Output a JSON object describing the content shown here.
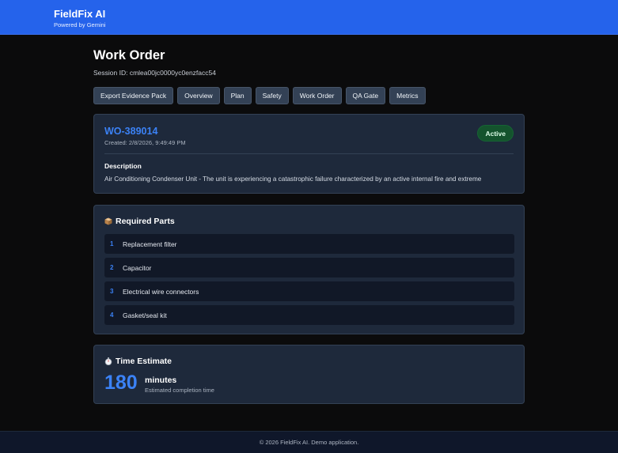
{
  "header": {
    "title": "FieldFix AI",
    "subtitle": "Powered by Gemini",
    "accent_color": "#2563eb"
  },
  "page": {
    "title": "Work Order",
    "session_label": "Session ID: cmlea00jc0000yc0enzfacc54"
  },
  "tabs": [
    {
      "label": "Export Evidence Pack"
    },
    {
      "label": "Overview"
    },
    {
      "label": "Plan"
    },
    {
      "label": "Safety"
    },
    {
      "label": "Work Order"
    },
    {
      "label": "QA Gate"
    },
    {
      "label": "Metrics"
    }
  ],
  "work_order": {
    "id": "WO-389014",
    "created": "Created: 2/8/2026, 9:49:49 PM",
    "status": "Active",
    "status_color": "#14532d",
    "description_label": "Description",
    "description": "Air Conditioning Condenser Unit - The unit is experiencing a catastrophic failure characterized by an active internal fire and extreme"
  },
  "parts": {
    "icon": "package-icon",
    "title": "Required Parts",
    "items": [
      {
        "num": "1",
        "name": "Replacement filter"
      },
      {
        "num": "2",
        "name": "Capacitor"
      },
      {
        "num": "3",
        "name": "Electrical wire connectors"
      },
      {
        "num": "4",
        "name": "Gasket/seal kit"
      }
    ]
  },
  "time_estimate": {
    "icon": "stopwatch-icon",
    "title": "Time Estimate",
    "value": "180",
    "unit": "minutes",
    "caption": "Estimated completion time"
  },
  "footer": {
    "text": "© 2026 FieldFix AI. Demo application."
  }
}
